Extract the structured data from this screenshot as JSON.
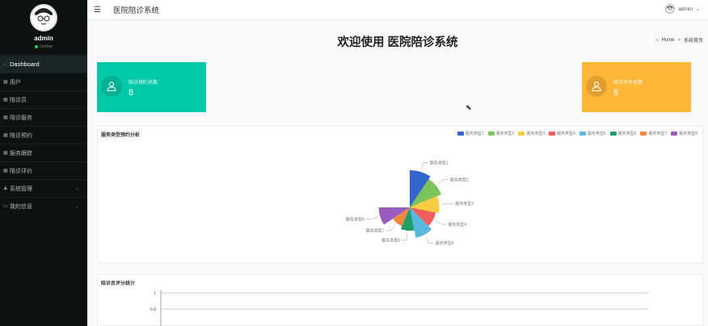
{
  "sidebar": {
    "user_name": "admin",
    "status": "Online",
    "items": [
      {
        "icon": "home-icon",
        "glyph": "⌂",
        "label": "Dashboard"
      },
      {
        "icon": "grid-icon",
        "glyph": "▦",
        "label": "用户"
      },
      {
        "icon": "grid-icon",
        "glyph": "▦",
        "label": "陪诊员"
      },
      {
        "icon": "grid-icon",
        "glyph": "▦",
        "label": "陪诊服务"
      },
      {
        "icon": "grid-icon",
        "glyph": "▦",
        "label": "陪诊预约"
      },
      {
        "icon": "grid-icon",
        "glyph": "▦",
        "label": "服务跟踪"
      },
      {
        "icon": "grid-icon",
        "glyph": "▦",
        "label": "陪诊评价"
      },
      {
        "icon": "user-icon",
        "glyph": "♟",
        "label": "系统管理"
      },
      {
        "icon": "document-icon",
        "glyph": "▭",
        "label": "我的信息"
      }
    ]
  },
  "topbar": {
    "title": "医院陪诊系统",
    "user": "admin"
  },
  "main": {
    "welcome": "欢迎使用 医院陪诊系统",
    "breadcrumb": {
      "home": "Home",
      "sep": ">",
      "current": "系统首页"
    },
    "cards": [
      {
        "label": "陪诊预约总数",
        "value": "8",
        "color": "#00c9a7"
      },
      {
        "label": "陪诊评价总数",
        "value": "8",
        "color": "#ffb737"
      }
    ],
    "panel1_title": "服务类型预约分析",
    "panel2_title": "陪诊员评分统计"
  },
  "chart_data": [
    {
      "type": "pie",
      "title": "服务类型预约分析",
      "legend_position": "top-right",
      "categories": [
        "服务类型1",
        "服务类型2",
        "服务类型3",
        "服务类型4",
        "服务类型5",
        "服务类型6",
        "服务类型7",
        "服务类型8"
      ],
      "values": [
        10,
        9,
        7.5,
        6.5,
        8,
        5.5,
        4.5,
        8
      ],
      "colors": [
        "#3366cc",
        "#7cc35a",
        "#f9cc43",
        "#f15c5c",
        "#58b7e0",
        "#1f9e6a",
        "#f5873e",
        "#9a5cc0"
      ],
      "rose_type": true
    },
    {
      "type": "line",
      "title": "陪诊员评分统计",
      "y_ticks": [
        "1",
        "0.8"
      ],
      "ylim": [
        0,
        1
      ]
    }
  ]
}
